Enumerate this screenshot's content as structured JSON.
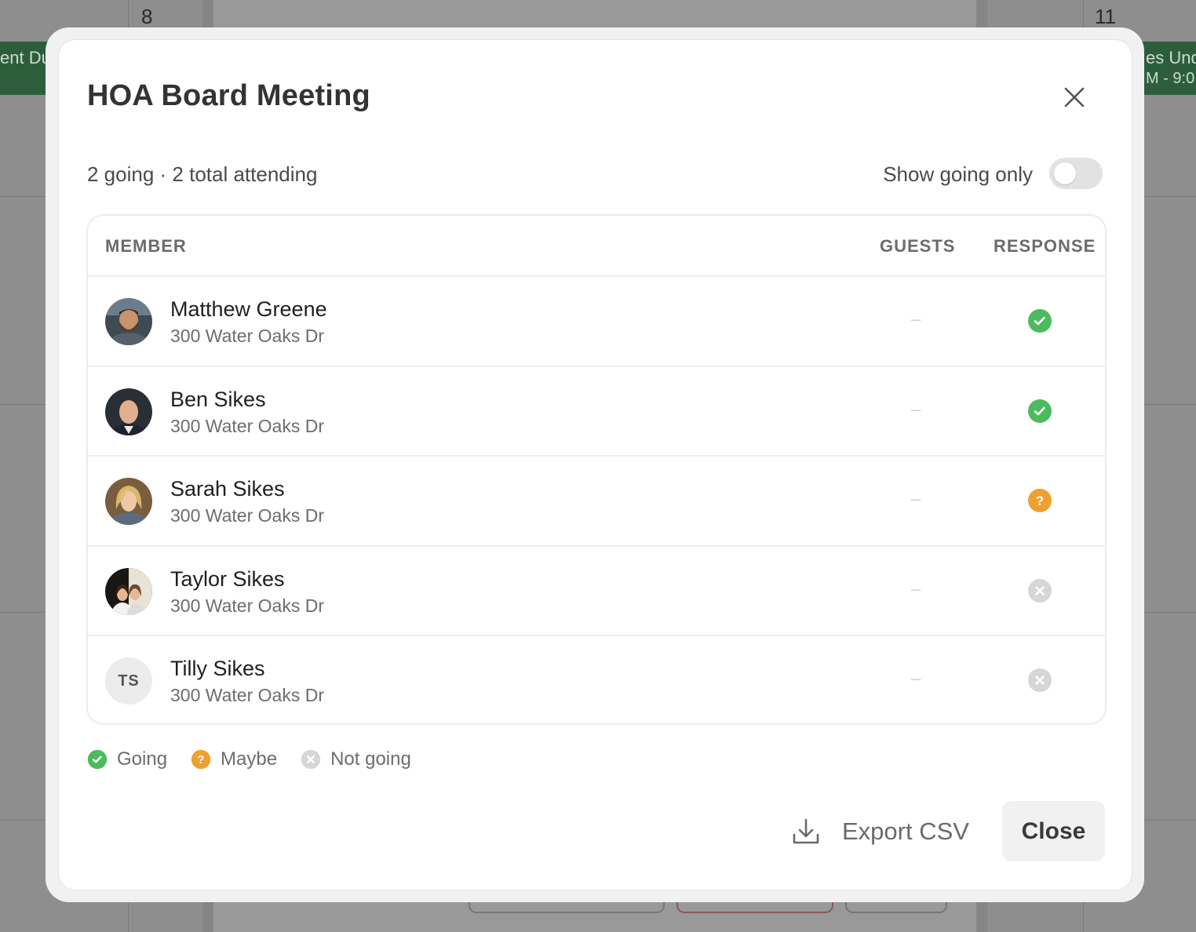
{
  "background": {
    "day_numbers": [
      "8",
      "11"
    ],
    "events": [
      {
        "title": "ent Du"
      },
      {
        "title": "es Und",
        "time": "M - 9:0"
      }
    ]
  },
  "modal": {
    "title": "HOA Board Meeting",
    "summary": "2 going · 2 total attending",
    "toggle": {
      "label": "Show going only",
      "on": false
    },
    "table": {
      "headers": {
        "member": "MEMBER",
        "guests": "GUESTS",
        "response": "RESPONSE"
      },
      "rows": [
        {
          "name": "Matthew Greene",
          "address": "300 Water Oaks Dr",
          "guests": "–",
          "response": "going",
          "avatar": "photo"
        },
        {
          "name": "Ben Sikes",
          "address": "300 Water Oaks Dr",
          "guests": "–",
          "response": "going",
          "avatar": "photo"
        },
        {
          "name": "Sarah Sikes",
          "address": "300 Water Oaks Dr",
          "guests": "–",
          "response": "maybe",
          "avatar": "photo"
        },
        {
          "name": "Taylor Sikes",
          "address": "300 Water Oaks Dr",
          "guests": "–",
          "response": "not-going",
          "avatar": "photo"
        },
        {
          "name": "Tilly Sikes",
          "address": "300 Water Oaks Dr",
          "guests": "–",
          "response": "not-going",
          "avatar": "initials",
          "initials": "TS"
        }
      ]
    },
    "legend": [
      {
        "key": "going",
        "label": "Going"
      },
      {
        "key": "maybe",
        "label": "Maybe"
      },
      {
        "key": "not-going",
        "label": "Not going"
      }
    ],
    "actions": {
      "export_label": "Export CSV",
      "close_label": "Close"
    },
    "colors": {
      "going": "#4cbb5e",
      "maybe": "#f0a030",
      "not_going": "#d6d6d6",
      "close_bg": "#f1f1f1"
    }
  }
}
